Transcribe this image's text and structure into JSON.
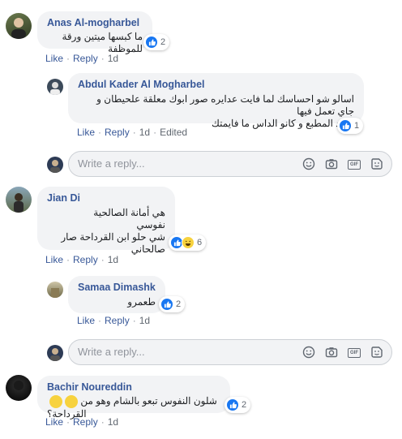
{
  "comments": [
    {
      "name": "Anas Al-mogharbel",
      "lines": [
        "ما كبسها ميتين ورقة للموظفة"
      ],
      "reactions": "2",
      "actions": {
        "like": "Like",
        "reply": "Reply",
        "time": "1d"
      }
    },
    {
      "name": "Abdul Kader Al Mogharbel",
      "lines": [
        "اسالو شو احساسك لما فايت عدايره صور ابوك معلقة علحيطان و جاي تعمل فيها",
        "العيد المطبع و كانو الداس ما فايمتك"
      ],
      "reactions": "1",
      "actions": {
        "like": "Like",
        "reply": "Reply",
        "time": "1d",
        "edited": "Edited"
      }
    },
    {
      "name": "Jian Di",
      "lines": [
        "هي أمانة الصالحية",
        "نفوسي",
        "شي حلو ابن القرداحة صار صالحاني"
      ],
      "reactions": "6",
      "actions": {
        "like": "Like",
        "reply": "Reply",
        "time": "1d"
      }
    },
    {
      "name": "Samaa Dimashk",
      "lines": [
        "طعمرو"
      ],
      "reactions": "2",
      "actions": {
        "like": "Like",
        "reply": "Reply",
        "time": "1d"
      }
    },
    {
      "name": "Bachir Noureddin",
      "lines": [
        "شلون النفوس تبعو بالشام وهو من القرداحة؟"
      ],
      "reactions": "2",
      "actions": {
        "like": "Like",
        "reply": "Reply",
        "time": "1d"
      }
    }
  ],
  "reply_box": {
    "placeholder": "Write a reply..."
  },
  "icons": [
    "like-icon",
    "haha-icon",
    "smiley-icon",
    "camera-icon",
    "gif-icon",
    "sticker-icon"
  ],
  "colors": {
    "link": "#385898",
    "bubble": "#f2f3f5",
    "like_blue": "#1877f2",
    "meta": "#606770"
  }
}
